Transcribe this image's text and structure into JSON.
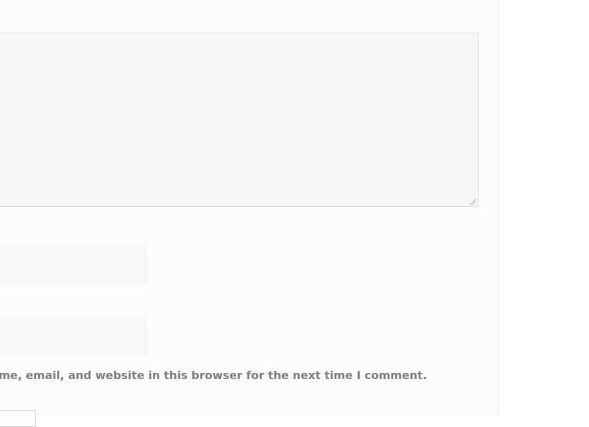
{
  "comment_form": {
    "top_fragment": "",
    "comment_value": "",
    "field_a_value": "",
    "field_b_value": "",
    "consent_text": "me, email, and website in this browser for the next time I comment.",
    "submit_label": ""
  }
}
